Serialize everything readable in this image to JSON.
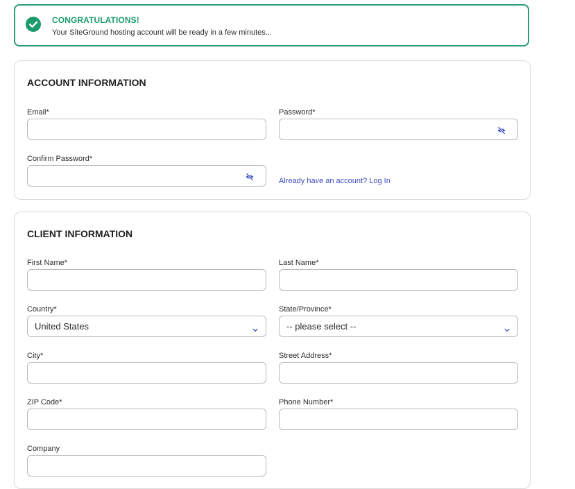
{
  "banner": {
    "title": "CONGRATULATIONS!",
    "message": "Your SiteGround hosting account will be ready in a few minutes...",
    "icon": "check-circle-icon",
    "color": "#1e9b6b"
  },
  "account": {
    "title": "ACCOUNT INFORMATION",
    "email_label": "Email*",
    "email_value": "",
    "password_label": "Password*",
    "password_value": "",
    "confirm_label": "Confirm Password*",
    "confirm_value": "",
    "login_link": "Already have an account? Log In",
    "toggle_icon": "eye-slash-icon"
  },
  "client": {
    "title": "CLIENT INFORMATION",
    "first_name_label": "First Name*",
    "first_name_value": "",
    "last_name_label": "Last Name*",
    "last_name_value": "",
    "country_label": "Country*",
    "country_value": "United States",
    "state_label": "State/Province*",
    "state_value": "-- please select --",
    "city_label": "City*",
    "city_value": "",
    "street_label": "Street Address*",
    "street_value": "",
    "zip_label": "ZIP Code*",
    "zip_value": "",
    "phone_label": "Phone Number*",
    "phone_value": "",
    "company_label": "Company",
    "company_value": ""
  },
  "colors": {
    "accent": "#3b4cc0",
    "success": "#1e9b6b",
    "border": "#b9b9b9"
  }
}
